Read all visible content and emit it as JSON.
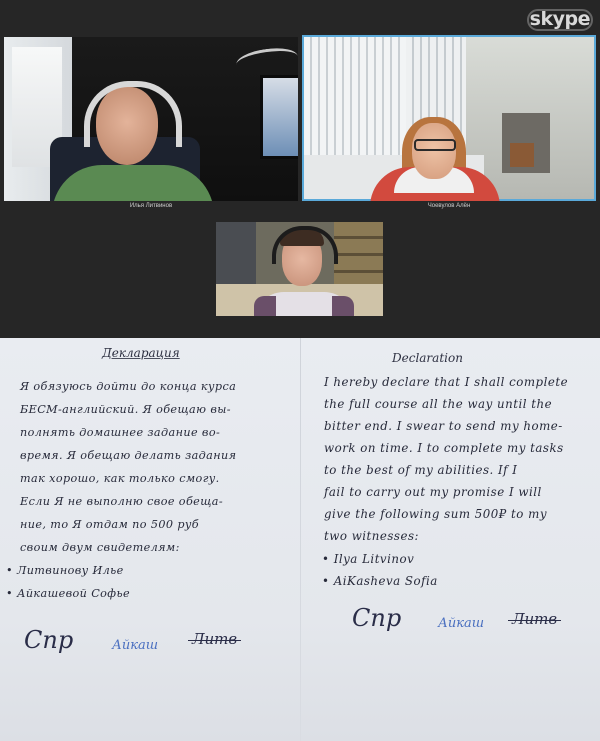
{
  "skype": {
    "logo": "skype",
    "participants": [
      {
        "name": "Илья Литвинов"
      },
      {
        "name": "Чоевулов Алён"
      },
      {
        "name": ""
      }
    ]
  },
  "declaration": {
    "left": {
      "title": "Декларация",
      "lines": [
        "Я обязуюсь дойти до конца курса",
        "БЕСМ-английский. Я обещаю вы-",
        "полнять домашнее задание во-",
        "время. Я обещаю делать задания",
        "так хорошо, как только смогу.",
        "Если Я не выполню свое обеща-",
        "ние, то Я отдам по 500 руб",
        "своим двум свидетелям:",
        "• Литвинову Илье",
        "• Айкашевой Софье"
      ],
      "signatures": [
        "Спр",
        "Айкаш",
        "Литв"
      ]
    },
    "right": {
      "title": "Declaration",
      "lines": [
        "I hereby declare that I shall complete",
        "the full course all the way until the",
        "bitter end. I swear to send my home-",
        "work on time. I to complete my tasks",
        "to the best of my abilities. If I",
        "fail to carry out my promise I will",
        "give the following sum 500₽ to my",
        "two witnesses:",
        "• Ilya Litvinov",
        "• AiKasheva Sofia"
      ],
      "signatures": [
        "Спр",
        "Айкаш",
        "Литв"
      ]
    }
  },
  "colors": {
    "skype_background": "#262626",
    "active_speaker_border": "#5aa9d9",
    "paper": "#e6e9ee",
    "ink": "#272a3a",
    "blue_ink": "#4a6fc0"
  }
}
